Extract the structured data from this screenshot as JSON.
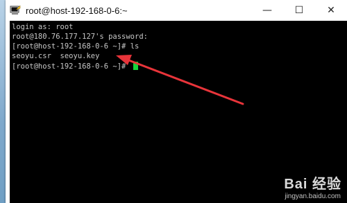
{
  "window": {
    "title": "root@host-192-168-0-6:~",
    "icon": "putty-terminal-icon",
    "controls": {
      "minimize": "—",
      "maximize": "☐",
      "close": "✕"
    }
  },
  "terminal": {
    "lines": [
      "login as: root",
      "root@180.76.177.127's password:",
      "[root@host-192-168-0-6 ~]# ls",
      "seoyu.csr  seoyu.key",
      "[root@host-192-168-0-6 ~]# "
    ],
    "text_color": "#c8c8c8",
    "cursor_color": "#16d43a",
    "background": "#000000"
  },
  "annotation": {
    "arrow_color": "#e8343a"
  },
  "watermark": {
    "logo_text": "Bai  经验",
    "url": "jingyan.baidu.com"
  }
}
